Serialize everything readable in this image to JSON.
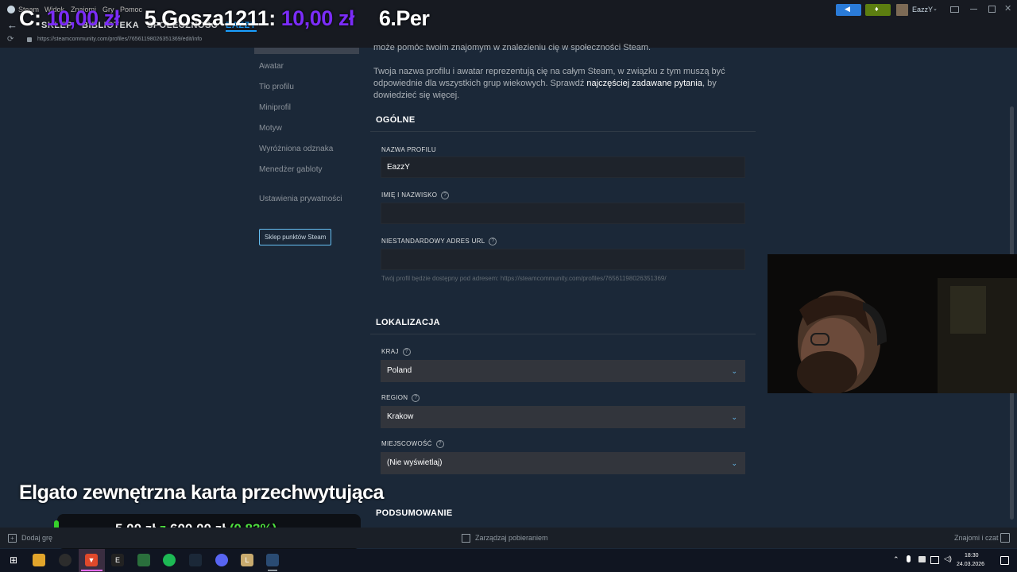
{
  "window": {
    "menu": [
      "Steam",
      "Widok",
      "Znajomi",
      "Gry",
      "Pomoc"
    ],
    "tabs": [
      "SKLEP",
      "BIBLIOTEKA",
      "SPOŁECZNOŚĆ",
      "EAZZY"
    ],
    "username": "EazzY",
    "url": "https://steamcommunity.com/profiles/76561198026351369/edit/info"
  },
  "sidebar": {
    "items": [
      "Awatar",
      "Tło profilu",
      "Miniprofil",
      "Motyw",
      "Wyróżniona odznaka",
      "Menedżer gabloty"
    ],
    "privacy": "Ustawienia prywatności",
    "points_button": "Sklep punktów Steam"
  },
  "main": {
    "intro_top": "może pomóc twoim znajomym w znalezieniu cię w społeczności Steam.",
    "intro_1": "Twoja nazwa profilu i awatar reprezentują cię na całym Steam, w związku z tym muszą być odpowiednie dla wszystkich grup wiekowych. Sprawdź",
    "intro_link": "najczęściej zadawane pytania",
    "intro_2": ", by dowiedzieć się więcej.",
    "general_heading": "OGÓLNE",
    "profile_name_label": "NAZWA PROFILU",
    "profile_name_value": "EazzY",
    "real_name_label": "IMIĘ I NAZWISKO",
    "real_name_value": "",
    "custom_url_label": "NIESTANDARDOWY ADRES URL",
    "custom_url_value": "",
    "custom_url_hint": "Twój profil będzie dostępny pod adresem: https://steamcommunity.com/profiles/76561198026351369/",
    "location_heading": "LOKALIZACJA",
    "country_label": "KRAJ",
    "country_value": "Poland",
    "region_label": "REGION",
    "region_value": "Krakow",
    "city_label": "MIEJSCOWOŚĆ",
    "city_value": "(Nie wyświetlaj)",
    "summary_heading": "PODSUMOWANIE"
  },
  "overlay": {
    "ticker_prefix": "C:",
    "ticker_amount_1": "10,00 zł",
    "ticker_rank_5": "5.",
    "ticker_name_5": "Gosza1211:",
    "ticker_amount_5": "10,00 zł",
    "ticker_rank_6": "6.",
    "ticker_name_6": "Per",
    "goal_title": "Elgato zewnętrzna karta przechwytująca",
    "goal_current": "5,00 zł",
    "goal_sep": "z",
    "goal_target": "600,00 zł",
    "goal_percent": "(0.83%)",
    "goal_fraction": 0.0083,
    "colors": {
      "purple": "#7b2cf8",
      "green": "#4ee03f"
    }
  },
  "bottombar": {
    "add_game": "Dodaj grę",
    "downloads": "Zarządzaj pobieraniem",
    "friends": "Znajomi i czat"
  },
  "taskbar": {
    "time": "18:30",
    "date": "24.03.2026"
  }
}
